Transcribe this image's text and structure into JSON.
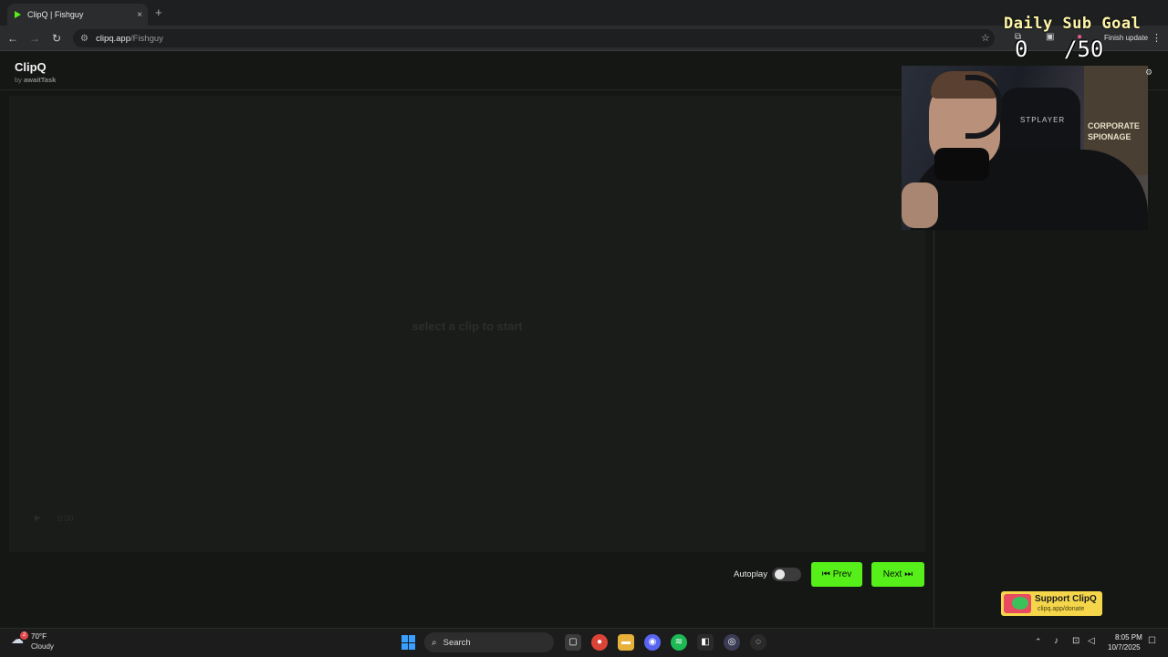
{
  "browser": {
    "tab_title": "ClipQ | Fishguy",
    "tab_close": "×",
    "new_tab": "+",
    "url_domain": "clipq.app",
    "url_path": "/Fishguy",
    "finish_update": "Finish update"
  },
  "overlay": {
    "subgoal_title": "Daily Sub Goal",
    "subgoal_current": "0",
    "subgoal_target": "/50",
    "webcam_chair_text": "STPLAYER",
    "webcam_poster_text": "CORPORATE SPIONAGE"
  },
  "app": {
    "title": "ClipQ",
    "by_prefix": "by",
    "by_author": "awaitTask"
  },
  "player": {
    "empty_message": "select a clip to start",
    "time": "0:00"
  },
  "controls": {
    "autoplay_label": "Autoplay",
    "autoplay_on": false,
    "prev_label": "Prev",
    "next_label": "Next"
  },
  "support": {
    "title": "Support ClipQ",
    "url": "clipq.app/donate"
  },
  "taskbar": {
    "weather_temp": "70°F",
    "weather_desc": "Cloudy",
    "weather_badge": "2",
    "search_label": "Search",
    "time": "8:05 PM",
    "date": "10/7/2025"
  },
  "colors": {
    "accent_green": "#56ef1a",
    "support_yellow": "#f5d64a",
    "background": "#151715"
  }
}
